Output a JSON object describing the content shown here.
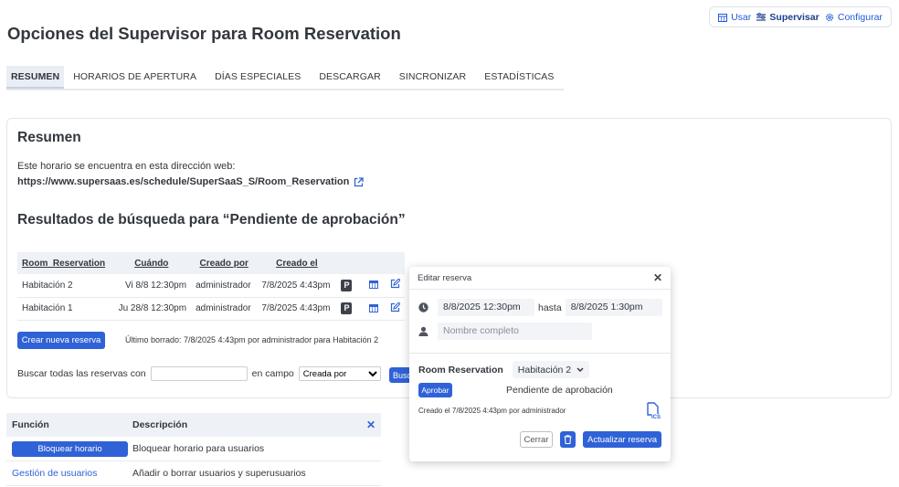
{
  "nav": {
    "items": [
      {
        "label": "Usar",
        "icon": "calendar-icon"
      },
      {
        "label": "Supervisar",
        "icon": "sliders-icon",
        "active": true
      },
      {
        "label": "Configurar",
        "icon": "gear-icon"
      }
    ]
  },
  "page_title": "Opciones del Supervisor para Room Reservation",
  "tabs": [
    "RESUMEN",
    "HORARIOS DE APERTURA",
    "DÍAS ESPECIALES",
    "DESCARGAR",
    "SINCRONIZAR",
    "ESTADÍSTICAS"
  ],
  "summary": {
    "heading": "Resumen",
    "address_label": "Este horario se encuentra en esta dirección web:",
    "url": "https://www.supersaas.es/schedule/SuperSaaS_S/Room_Reservation"
  },
  "results": {
    "heading": "Resultados de búsqueda para “Pendiente de aprobación”",
    "columns": [
      "Room_Reservation",
      "Cuándo",
      "Creado por",
      "Creado el"
    ],
    "rows": [
      {
        "room": "Habitación 2",
        "when": "Vi 8/8 12:30pm",
        "by": "administrador",
        "created": "7/8/2025 4:43pm",
        "badge": "P"
      },
      {
        "room": "Habitación 1",
        "when": "Ju 28/8 12:30pm",
        "by": "administrador",
        "created": "7/8/2025 4:43pm",
        "badge": "P"
      }
    ],
    "new_button": "Crear nueva reserva",
    "last_deleted": "Último borrado: 7/8/2025 4:43pm por administrador para Habitación 2"
  },
  "search": {
    "label_before": "Buscar todas las reservas con",
    "label_field": "en campo",
    "field_selected": "Creada por",
    "button": "Buscar"
  },
  "functions": {
    "headers": [
      "Función",
      "Descripción"
    ],
    "rows": [
      {
        "label": "Bloquear horario",
        "desc": "Bloquear horario para usuarios"
      },
      {
        "label": "Gestión de usuarios",
        "desc": "Añadir o borrar usuarios y superusuarios"
      }
    ]
  },
  "modal": {
    "title": "Editar reserva",
    "start": "8/8/2025 12:30pm",
    "until": "hasta",
    "end": "8/8/2025 1:30pm",
    "name_placeholder": "Nombre completo",
    "room_label": "Room Reservation",
    "room_value": "Habitación 2",
    "approve_button": "Aprobar",
    "status": "Pendiente de aprobación",
    "created": "Creado el 7/8/2025 4:43pm por administrador",
    "close_button": "Cerrar",
    "update_button": "Actualizar reserva"
  },
  "colors": {
    "accent": "#2f62d6",
    "header_bg": "#eef1f6"
  }
}
